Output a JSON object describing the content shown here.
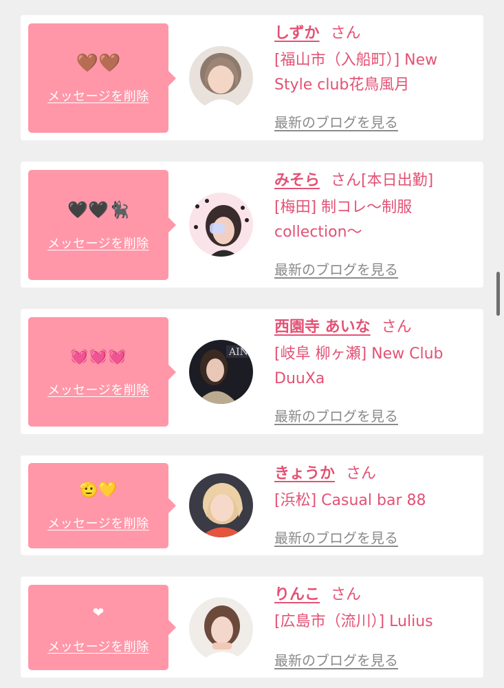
{
  "common": {
    "delete_label": "メッセージを削除",
    "blog_label": "最新のブログを見る",
    "honorific": "さん"
  },
  "colors": {
    "bubble": "#ff97a8",
    "accent": "#e35174",
    "link_gray": "#8a8a8a",
    "background": "#efefef"
  },
  "messages": [
    {
      "emoji": "🤎🤎",
      "name": "しずか",
      "suffix": "",
      "shop": "[福山市（入船町）] New Style club花鳥風月"
    },
    {
      "emoji": "🖤🖤🐈‍⬛",
      "name": "みそら",
      "suffix": "[本日出勤]",
      "shop": "[梅田] 制コレ〜制服collection〜"
    },
    {
      "emoji": "💓💓💓",
      "name": "西園寺 あいな",
      "suffix": "",
      "shop": "[岐阜 柳ヶ瀬] New Club DuuXa"
    },
    {
      "emoji": "🫡💛",
      "name": "きょうか",
      "suffix": "",
      "shop": "[浜松] Casual bar 88"
    },
    {
      "emoji": "❤︎",
      "name": "りんこ",
      "suffix": "",
      "shop": "[広島市（流川）] Lulius"
    }
  ]
}
